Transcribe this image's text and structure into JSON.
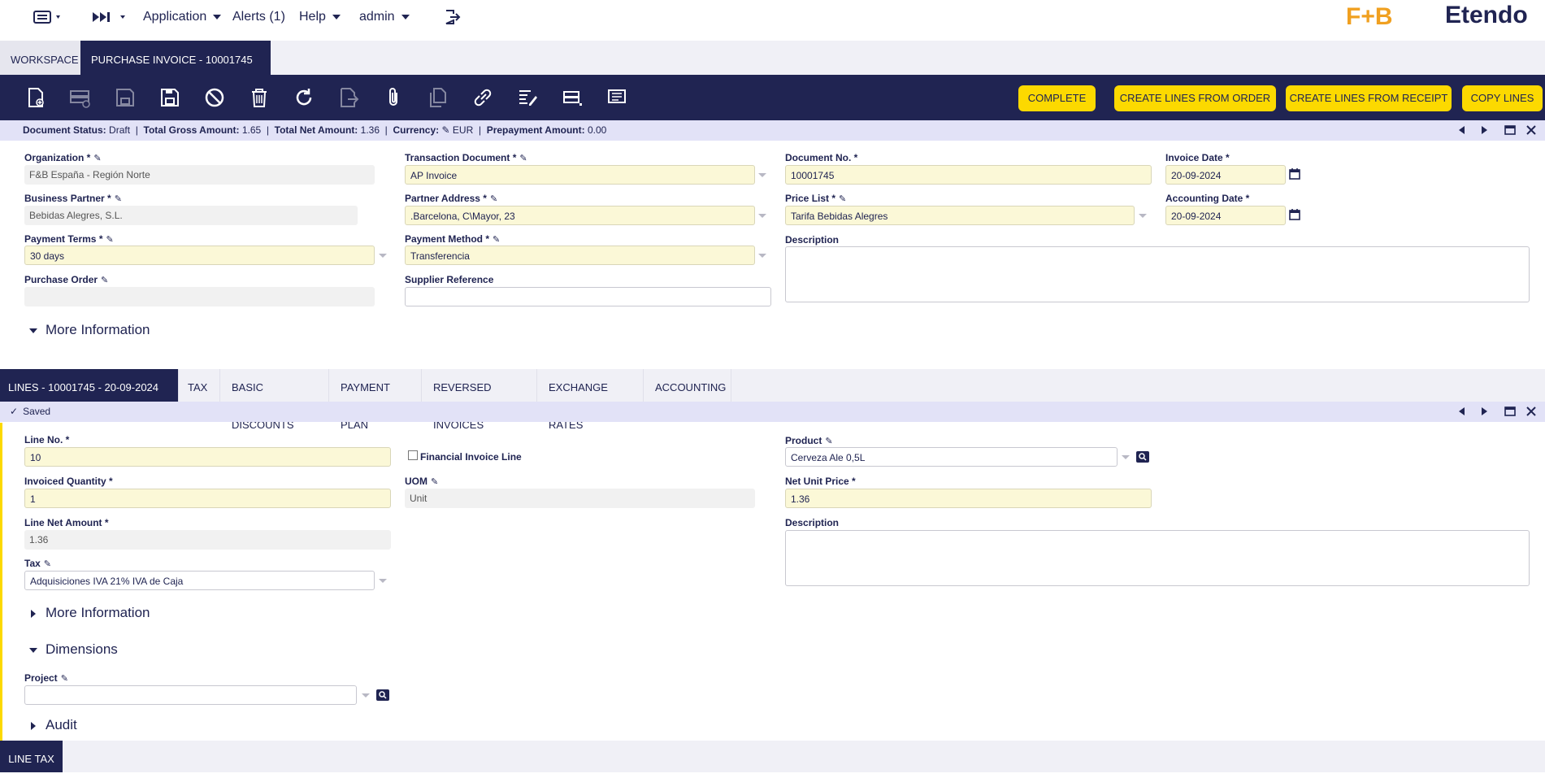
{
  "nav": {
    "application": "Application",
    "alerts": "Alerts (1)",
    "help": "Help",
    "user": "admin",
    "logo_fb": "F+B",
    "logo_etendo": "Etendo"
  },
  "tabs": {
    "workspace": "WORKSPACE",
    "active": "PURCHASE INVOICE - 10001745 ...",
    "close": "×"
  },
  "toolbar": {
    "complete": "COMPLETE",
    "create_from_order": "CREATE LINES FROM ORDER",
    "create_from_receipt": "CREATE LINES FROM RECEIPT",
    "copy_lines": "COPY LINES"
  },
  "header_status": {
    "text_parts": [
      {
        "label": "Document Status:",
        "value": "Draft"
      },
      {
        "label": "Total Gross Amount:",
        "value": "1.65"
      },
      {
        "label": "Total Net Amount:",
        "value": "1.36"
      },
      {
        "label": "Currency:",
        "value": "EUR"
      },
      {
        "label": "Prepayment Amount:",
        "value": "0.00"
      }
    ]
  },
  "header": {
    "organization": {
      "label": "Organization *",
      "value": "F&B España - Región Norte"
    },
    "transaction_document": {
      "label": "Transaction Document *",
      "value": "AP Invoice"
    },
    "document_no": {
      "label": "Document No. *",
      "value": "10001745"
    },
    "invoice_date": {
      "label": "Invoice Date *",
      "value": "20-09-2024"
    },
    "business_partner": {
      "label": "Business Partner *",
      "value": "Bebidas Alegres, S.L."
    },
    "partner_address": {
      "label": "Partner Address *",
      "value": ".Barcelona, C\\Mayor, 23"
    },
    "price_list": {
      "label": "Price List *",
      "value": "Tarifa Bebidas Alegres"
    },
    "accounting_date": {
      "label": "Accounting Date *",
      "value": "20-09-2024"
    },
    "payment_terms": {
      "label": "Payment Terms *",
      "value": "30 days"
    },
    "payment_method": {
      "label": "Payment Method *",
      "value": "Transferencia"
    },
    "description": {
      "label": "Description",
      "value": ""
    },
    "purchase_order": {
      "label": "Purchase Order",
      "value": ""
    },
    "supplier_reference": {
      "label": "Supplier Reference",
      "value": ""
    },
    "more_info": "More Information"
  },
  "subtabs": [
    "LINES - 10001745 - 20-09-2024 ...",
    "TAX",
    "BASIC DISCOUNTS",
    "PAYMENT PLAN",
    "REVERSED INVOICES",
    "EXCHANGE RATES",
    "ACCOUNTING"
  ],
  "lines_status": "Saved",
  "lines": {
    "line_no": {
      "label": "Line No. *",
      "value": "10"
    },
    "financial_invoice_line": "Financial Invoice Line",
    "product": {
      "label": "Product",
      "value": "Cerveza Ale 0,5L"
    },
    "invoiced_quantity": {
      "label": "Invoiced Quantity *",
      "value": "1"
    },
    "uom": {
      "label": "UOM",
      "value": "Unit"
    },
    "net_unit_price": {
      "label": "Net Unit Price *",
      "value": "1.36"
    },
    "line_net_amount": {
      "label": "Line Net Amount *",
      "value": "1.36"
    },
    "description": {
      "label": "Description",
      "value": ""
    },
    "tax": {
      "label": "Tax",
      "value": "Adquisiciones IVA 21% IVA de Caja"
    },
    "more_info": "More Information",
    "dimensions": "Dimensions",
    "project": {
      "label": "Project",
      "value": ""
    },
    "audit": "Audit"
  },
  "bottom_tab": "LINE TAX",
  "pen_glyph": "✎"
}
